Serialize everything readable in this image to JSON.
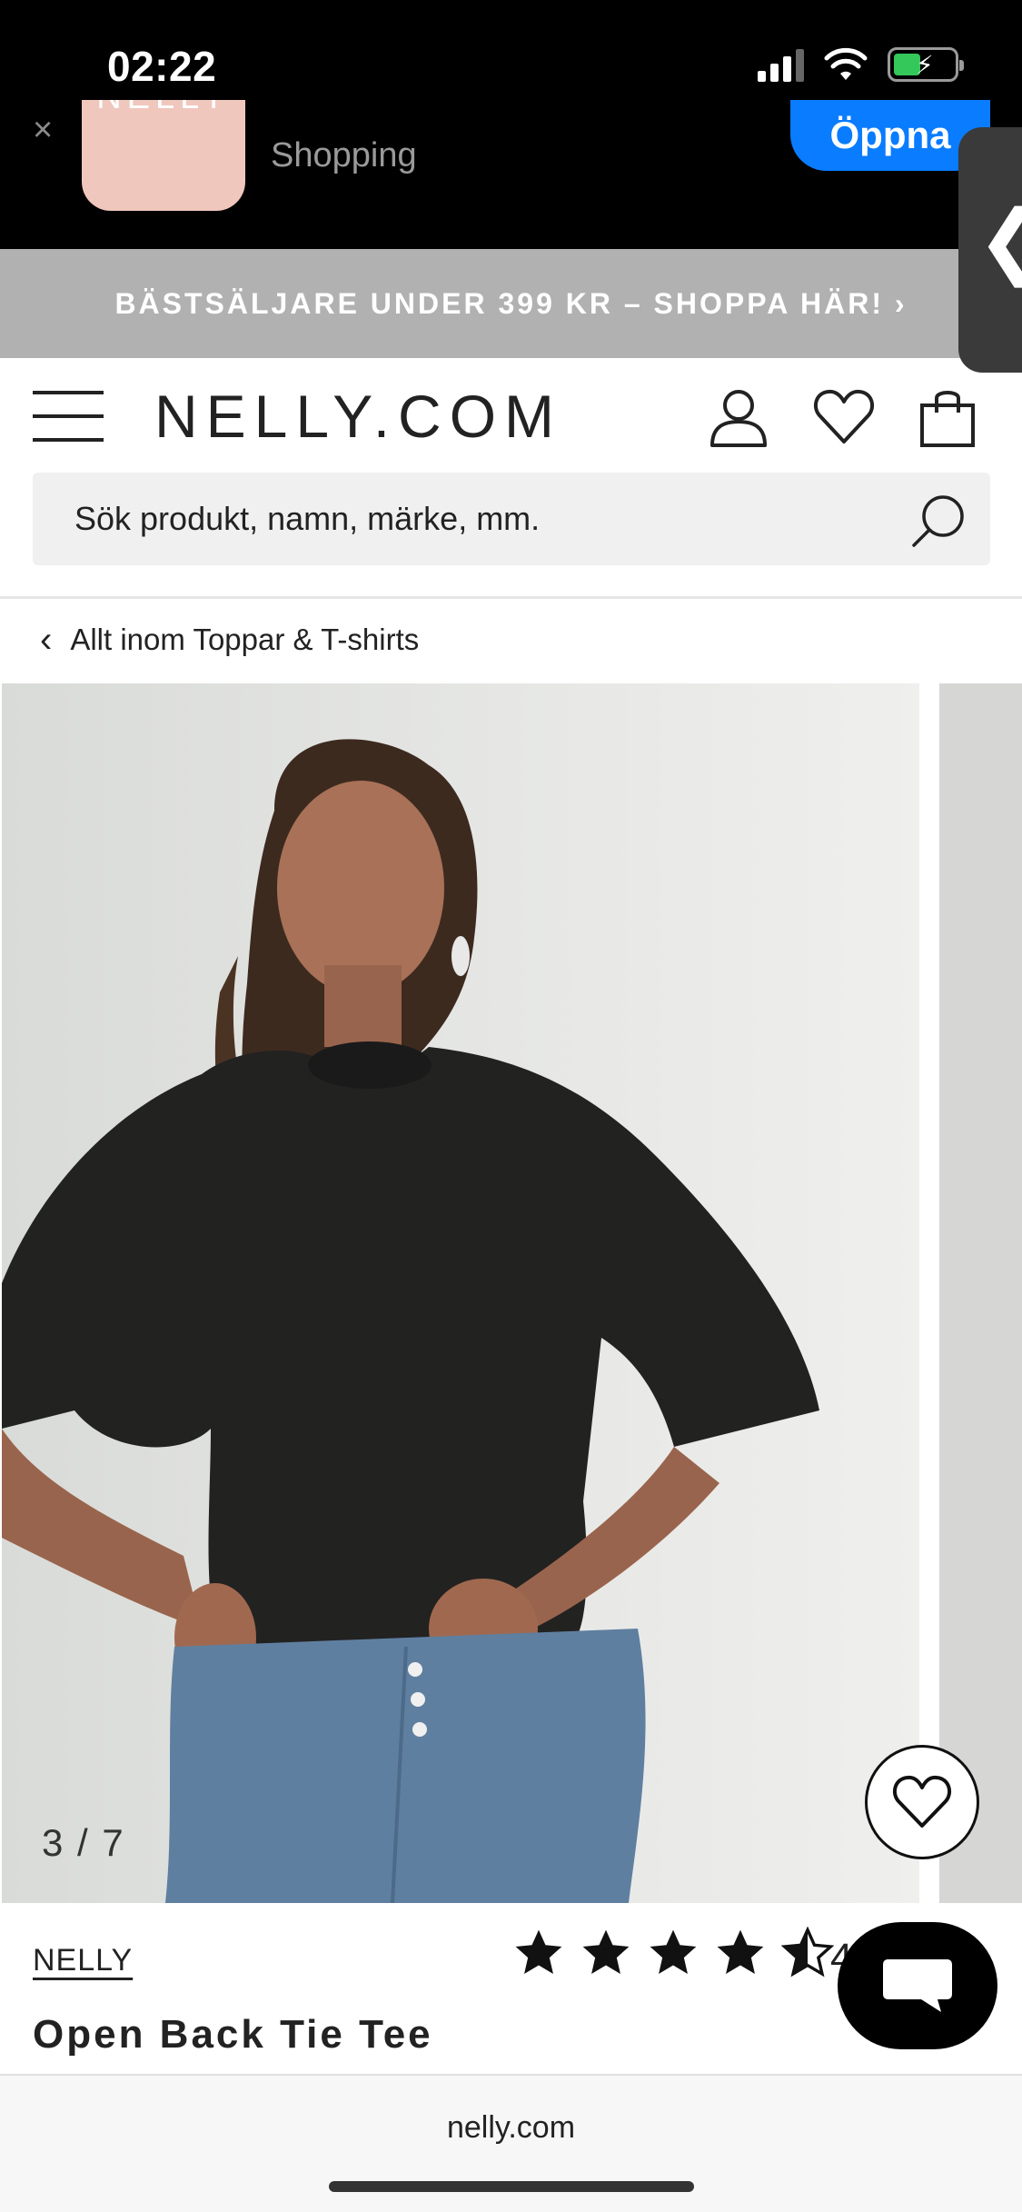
{
  "status_bar": {
    "time": "02:22"
  },
  "app_banner": {
    "close": "×",
    "app_icon_text": "NELLY",
    "subtitle": "Shopping",
    "open_label": "Öppna"
  },
  "side_handle": {
    "glyph": "❮"
  },
  "promo": {
    "text": "BÄSTSÄLJARE UNDER 399 KR – SHOPPA HÄR! ›"
  },
  "header": {
    "logo": "NELLY.COM"
  },
  "search": {
    "placeholder": "Sök produkt, namn, märke, mm."
  },
  "breadcrumb": {
    "chevron": "‹",
    "label": "Allt inom Toppar & T-shirts"
  },
  "gallery": {
    "counter": "3 / 7"
  },
  "product": {
    "brand": "NELLY",
    "title": "Open Back Tie Tee",
    "rating_visible": "4",
    "rating_stars": 4.5
  },
  "browser": {
    "url": "nelly.com"
  },
  "colors": {
    "promo_bg": "#b1b1b1",
    "open_button": "#0a7cff",
    "app_icon": "#f0c7bd",
    "battery": "#34c759"
  },
  "icons": {
    "menu": "hamburger-icon",
    "account": "user-icon",
    "wishlist": "heart-icon",
    "cart": "shopping-bag-icon",
    "search": "search-icon",
    "chat": "chat-bubble-icon"
  }
}
